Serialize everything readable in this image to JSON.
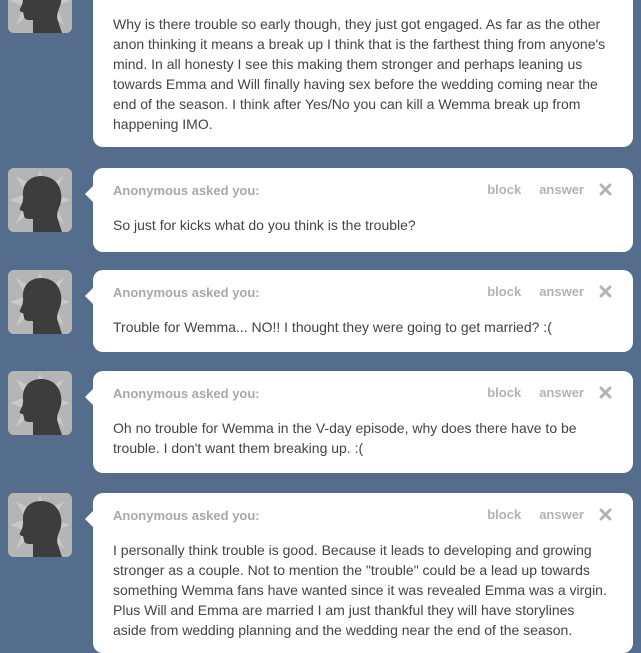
{
  "colors": {
    "background": "#546d8d",
    "card": "#ffffff",
    "muted_text": "#a8a8a8",
    "body_text": "#444444"
  },
  "icons": {
    "avatar": "anonymous-silhouette-icon",
    "close": "close-x-icon"
  },
  "posts": [
    {
      "asker": "",
      "block_label": "",
      "answer_label": "",
      "question": "Why is there trouble so early though, they just got engaged. As far as the other anon thinking it means a break up I think that is the farthest thing from anyone's mind. In all honesty I see this making them stronger and perhaps leaning us towards Emma and Will finally having sex before the wedding coming near the end of the season. I think after Yes/No you can kill a Wemma break up from happening IMO."
    },
    {
      "asker": "Anonymous asked you:",
      "block_label": "block",
      "answer_label": "answer",
      "question": "So just for kicks what do you think is the trouble?"
    },
    {
      "asker": "Anonymous asked you:",
      "block_label": "block",
      "answer_label": "answer",
      "question": "Trouble for Wemma... NO!! I thought they were going to get married? :("
    },
    {
      "asker": "Anonymous asked you:",
      "block_label": "block",
      "answer_label": "answer",
      "question": "Oh no trouble for Wemma in the V-day episode, why does there have to be trouble. I don't want them breaking up. :("
    },
    {
      "asker": "Anonymous asked you:",
      "block_label": "block",
      "answer_label": "answer",
      "question": "I personally think trouble is good. Because it leads to developing and growing stronger as a couple. Not to mention the \"trouble\" could be a lead up towards something Wemma fans have wanted since it was revealed Emma was a virgin. Plus Will and Emma are married I am just thankful they will have storylines aside from wedding planning and the wedding near the end of the season."
    }
  ]
}
